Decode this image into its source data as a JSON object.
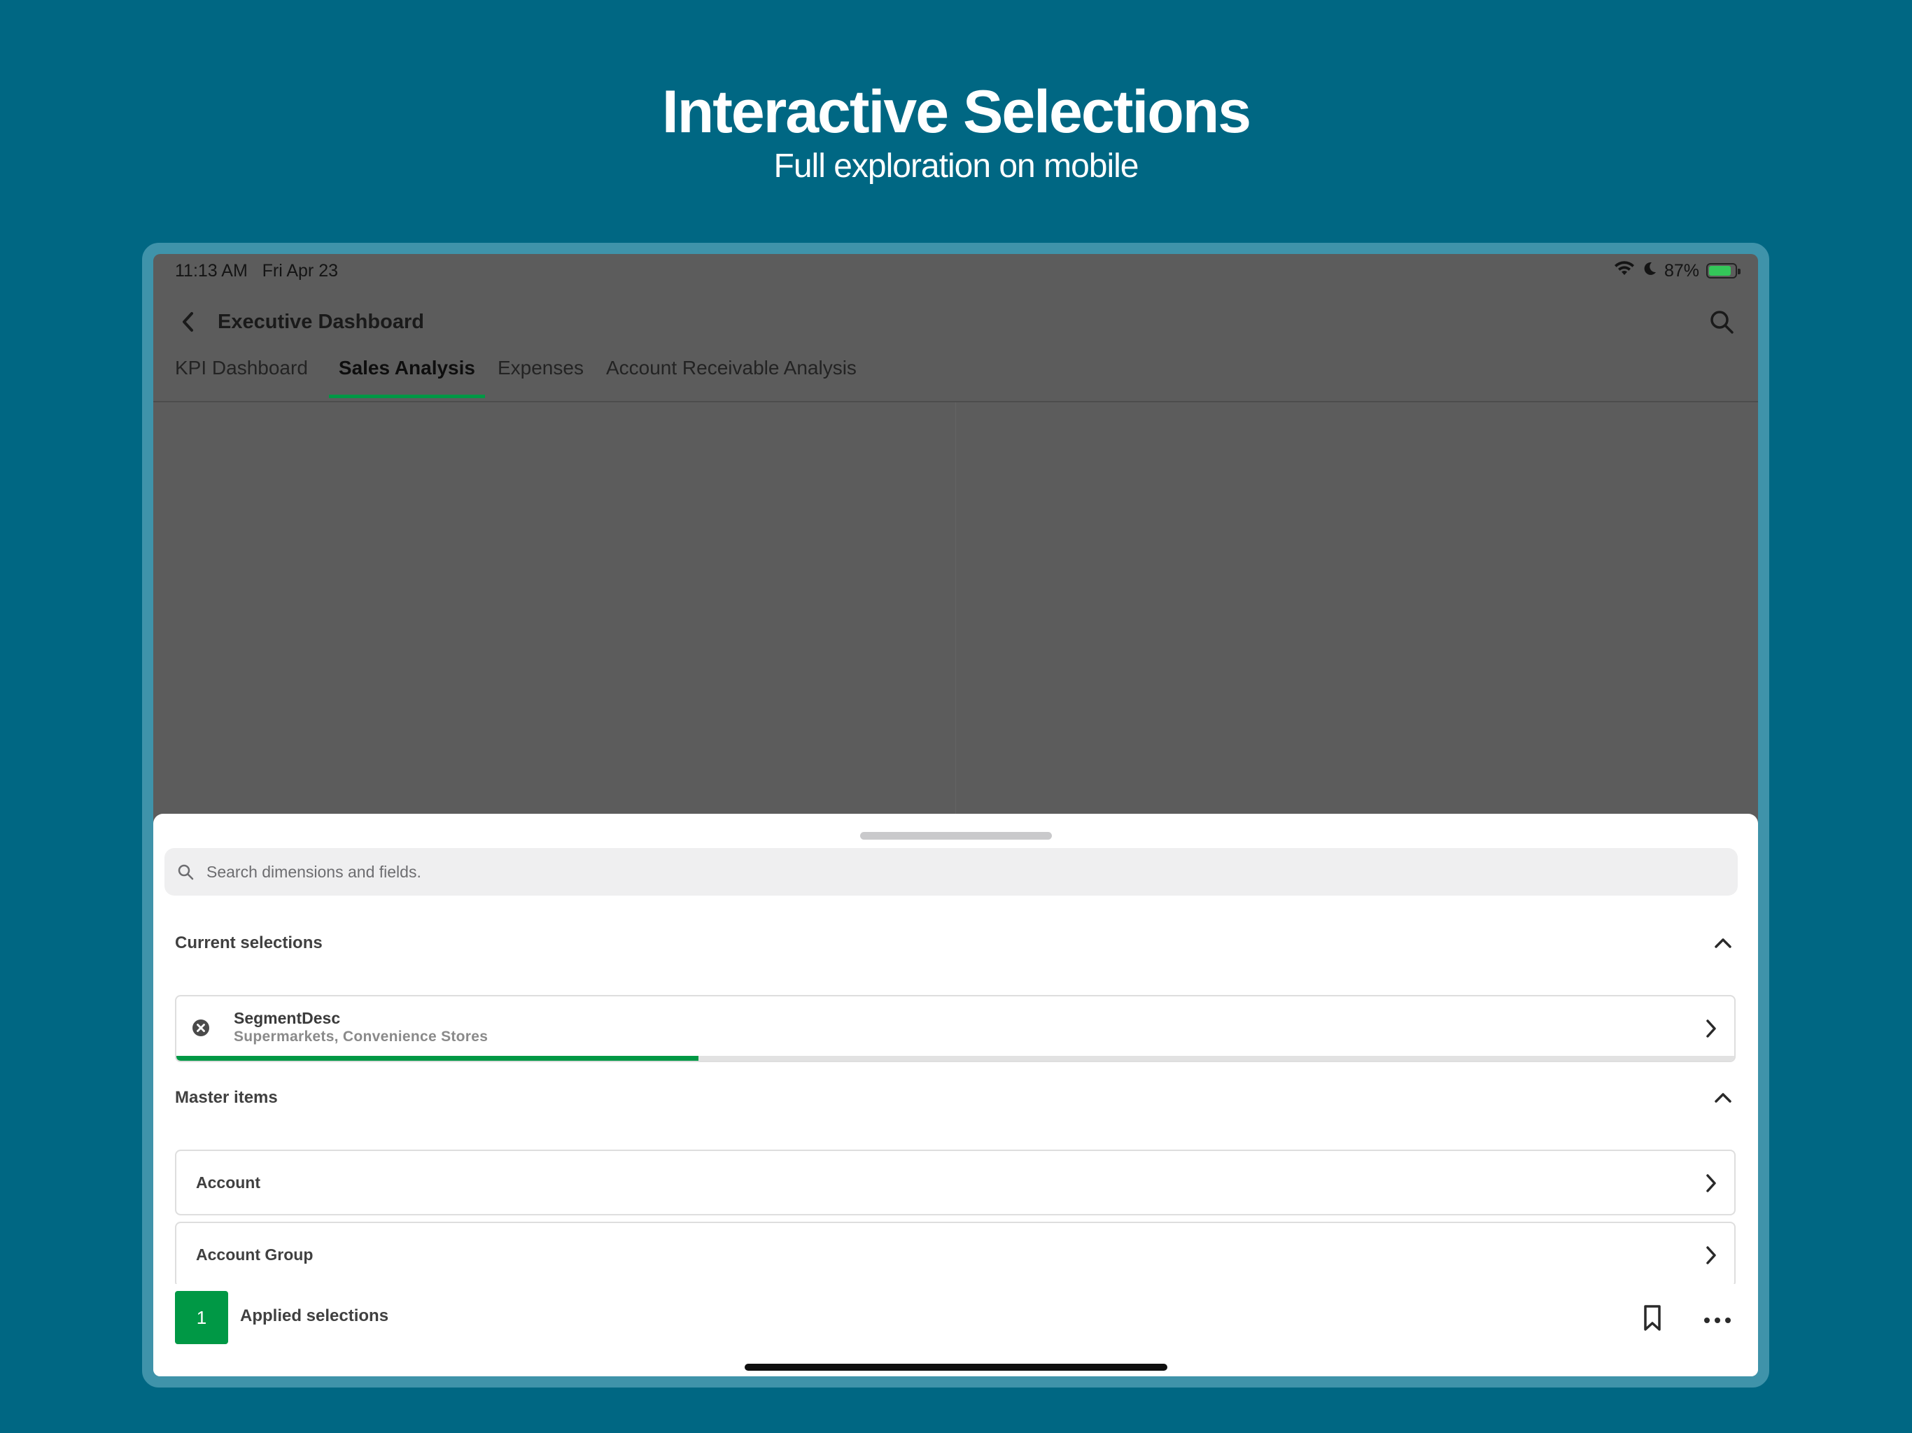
{
  "hero": {
    "title": "Interactive Selections",
    "subtitle": "Full exploration on mobile"
  },
  "status_bar": {
    "time": "11:13 AM",
    "date": "Fri Apr 23",
    "battery": "87%",
    "battery_level": 0.87,
    "icons": [
      "wifi-icon",
      "moon-icon",
      "battery-charging-icon"
    ]
  },
  "header": {
    "title": "Executive Dashboard",
    "back_icon": "chevron-left-icon",
    "search_icon": "search-icon"
  },
  "tabs": [
    {
      "label": "KPI Dashboard",
      "active": false
    },
    {
      "label": "Sales Analysis",
      "active": true
    },
    {
      "label": "Expenses",
      "active": false
    },
    {
      "label": "Account Receivable Analysis",
      "active": false
    }
  ],
  "sheet": {
    "search_placeholder": "Search dimensions and fields.",
    "current_selections": {
      "title": "Current selections",
      "items": [
        {
          "field": "SegmentDesc",
          "values": "Supermarkets, Convenience Stores",
          "selected_fraction": 0.335
        }
      ]
    },
    "master_items": {
      "title": "Master items",
      "items": [
        {
          "label": "Account"
        },
        {
          "label": "Account Group"
        }
      ]
    },
    "footer": {
      "applied_count": "1",
      "applied_label": "Applied selections",
      "bookmark_icon": "bookmark-icon",
      "more_icon": "more-horizontal-icon"
    }
  },
  "colors": {
    "background": "#006783",
    "accent_green": "#009845",
    "overlay": "#5c5c5c"
  }
}
